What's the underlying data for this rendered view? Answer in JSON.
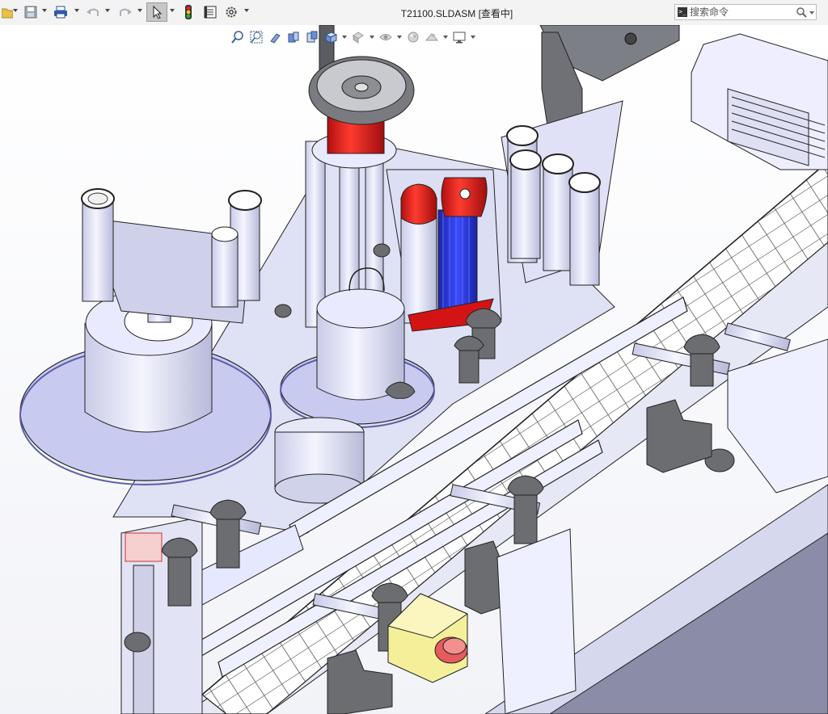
{
  "window": {
    "title": "T21100.SLDASM [查看中]"
  },
  "toolbar": {
    "items": [
      {
        "id": "open",
        "icon": "folder-open-icon"
      },
      {
        "id": "save",
        "icon": "save-icon"
      },
      {
        "id": "print",
        "icon": "print-icon"
      },
      {
        "id": "undo",
        "icon": "undo-icon"
      },
      {
        "id": "redo",
        "icon": "redo-icon"
      },
      {
        "id": "select",
        "icon": "select-arrow-icon",
        "active": true
      },
      {
        "id": "rebuild",
        "icon": "traffic-light-icon"
      },
      {
        "id": "file-properties",
        "icon": "file-properties-icon"
      },
      {
        "id": "options",
        "icon": "gear-icon"
      }
    ]
  },
  "search": {
    "placeholder": "搜索命令",
    "icon": "magnifier-icon"
  },
  "heads_up_toolbar": {
    "items": [
      "zoom-to-fit-icon",
      "zoom-to-area-icon",
      "previous-view-icon",
      "section-view-icon",
      "dynamic-annotation-icon",
      "view-orientation-icon",
      "display-style-icon",
      "hide-show-items-icon",
      "edit-appearance-icon",
      "apply-scene-icon",
      "view-settings-icon"
    ]
  },
  "model": {
    "description_type": "3d-assembly",
    "colors": {
      "background": "#ffffff",
      "metal": "#d7d9f2",
      "metal_dark": "#a9accf",
      "red_part": "#e41b17",
      "blue_part": "#2634d6",
      "yellow_box": "#f5ef9a",
      "knob": "#6c6d71",
      "edge": "#1a1a1a"
    }
  }
}
